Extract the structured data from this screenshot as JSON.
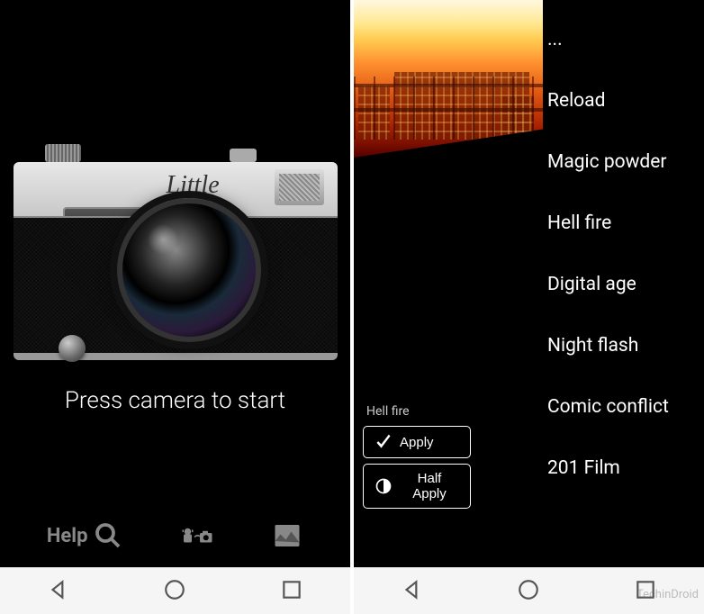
{
  "left": {
    "brand": "Little",
    "instruction": "Press camera to start",
    "toolbar": {
      "help_label": "Help",
      "help_icon": "magnify-icon",
      "camera_icon": "android-camera-icon",
      "gallery_icon": "gallery-icon"
    }
  },
  "right": {
    "current_filter": "Hell fire",
    "apply_label": "Apply",
    "half_apply_label": "Half Apply",
    "filters": [
      "...",
      "Reload",
      "Magic powder",
      "Hell fire",
      "Digital age",
      "Night flash",
      "Comic conflict",
      "201 Film"
    ]
  },
  "watermark": "TechinDroid"
}
